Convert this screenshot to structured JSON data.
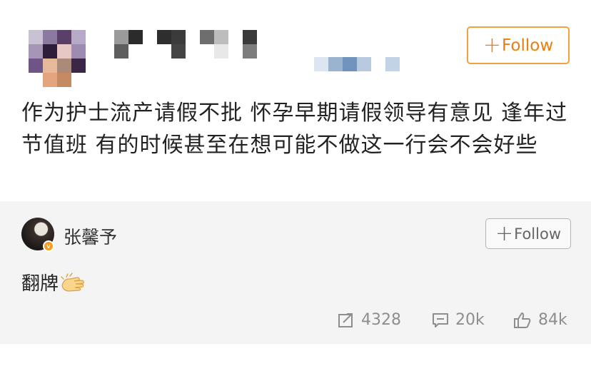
{
  "post": {
    "follow_label": "Follow",
    "follow_plus": "+",
    "text": "作为护士流产请假不批  怀孕早期请假领导有意见  逢年过节值班   有的时候甚至在想可能不做这一行会不会好些"
  },
  "repost": {
    "username": "张馨予",
    "follow_label": "Follow",
    "follow_plus": "+",
    "text": "翻牌",
    "badge": "v"
  },
  "stats": {
    "reposts": "4328",
    "comments": "20k",
    "likes": "84k"
  },
  "colors": {
    "accent_orange": "#eb7e10",
    "repost_bg": "#f4f4f4",
    "stat_gray": "#8e8e8e"
  },
  "icons": [
    "share-icon",
    "comment-icon",
    "like-icon",
    "clapping-hands-emoji"
  ]
}
